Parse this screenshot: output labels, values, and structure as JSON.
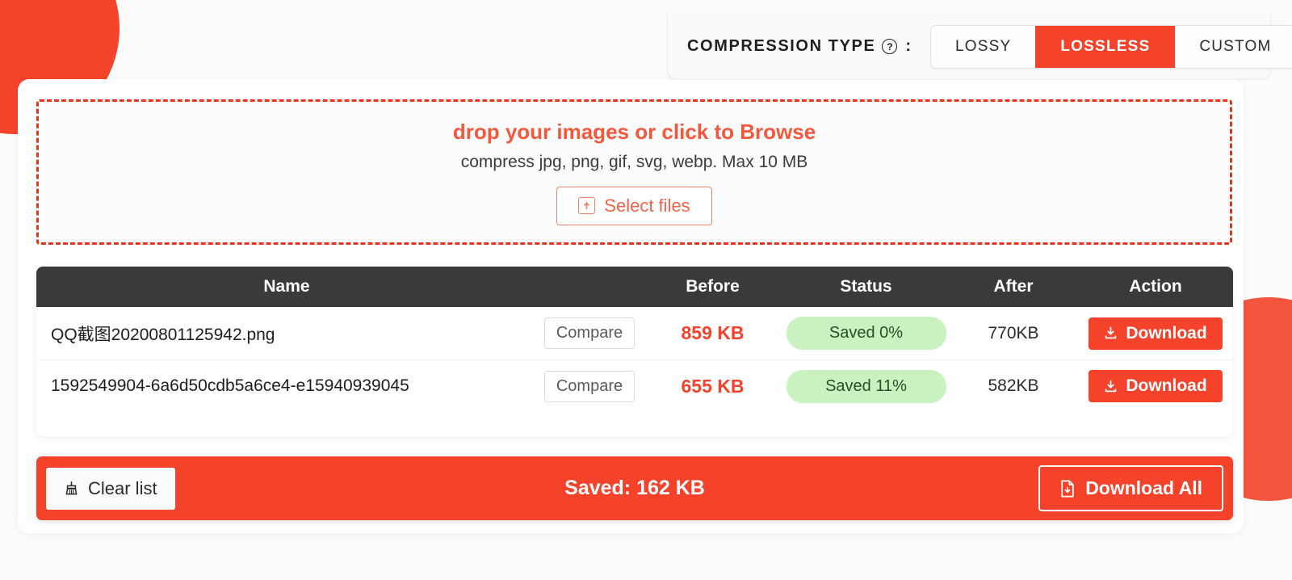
{
  "compression": {
    "label": "COMPRESSION TYPE",
    "help_icon": "question-circle-icon",
    "help_glyph": "?",
    "colon": ":",
    "options": [
      "LOSSY",
      "LOSSLESS",
      "CUSTOM"
    ],
    "selected": "LOSSLESS",
    "accent_color": "#f4432a"
  },
  "dropzone": {
    "title": "drop your images or click to Browse",
    "subtitle": "compress jpg, png, gif, svg, webp. Max 10 MB",
    "button_label": "Select files",
    "button_icon": "upload-box-icon",
    "border_color": "#e5331c",
    "title_color": "#f4573c"
  },
  "table": {
    "headers": [
      "Name",
      "Before",
      "Status",
      "After",
      "Action"
    ],
    "header_bg": "#3b3a39",
    "rows": [
      {
        "name": "QQ截图20200801125942.png",
        "truncated": false,
        "compare_label": "Compare",
        "before": "859 KB",
        "status": "Saved 0%",
        "after": "770KB",
        "action_label": "Download",
        "action_icon": "download-icon",
        "status_bg": "#c9f2c0"
      },
      {
        "name": "1592549904-6a6d50cdb5a6ce4-e15940939045",
        "truncated": true,
        "compare_label": "Compare",
        "before": "655 KB",
        "status": "Saved 11%",
        "after": "582KB",
        "action_label": "Download",
        "action_icon": "download-icon",
        "status_bg": "#c9f2c0"
      }
    ]
  },
  "bottombar": {
    "clear_label": "Clear list",
    "clear_icon": "broom-icon",
    "saved_total": "Saved: 162 KB",
    "download_all_label": "Download All",
    "download_all_icon": "file-download-icon",
    "bg_color": "#f4432a"
  }
}
